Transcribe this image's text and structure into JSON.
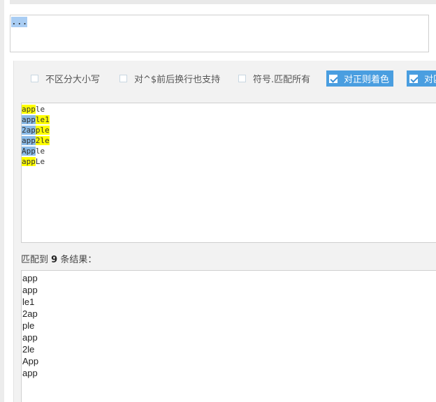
{
  "regex": {
    "value": "..."
  },
  "options": [
    {
      "label": "不区分大小写",
      "checked": false
    },
    {
      "label": "对^$前后换行也支持",
      "checked": false
    },
    {
      "label": "符号.匹配所有",
      "checked": false
    },
    {
      "label": "对正则着色",
      "checked": true
    },
    {
      "label": "对匹",
      "checked": true
    }
  ],
  "test_text": {
    "lines": [
      [
        {
          "t": "app",
          "c": "yellow"
        },
        {
          "t": "le",
          "c": ""
        }
      ],
      [
        {
          "t": "app",
          "c": "blue"
        },
        {
          "t": "le1",
          "c": "yellow"
        }
      ],
      [
        {
          "t": "2ap",
          "c": "blue"
        },
        {
          "t": "ple",
          "c": "yellow"
        }
      ],
      [
        {
          "t": "app",
          "c": "blue"
        },
        {
          "t": "2le",
          "c": "yellow"
        }
      ],
      [
        {
          "t": "App",
          "c": "blue"
        },
        {
          "t": "le",
          "c": ""
        }
      ],
      [
        {
          "t": "app",
          "c": "yellow"
        },
        {
          "t": "Le",
          "c": ""
        }
      ]
    ]
  },
  "result": {
    "prefix": "匹配到 ",
    "count": "9",
    "suffix": " 条结果：",
    "items": [
      "app",
      "app",
      "le1",
      "2ap",
      "ple",
      "app",
      "2le",
      "App",
      "app"
    ]
  },
  "colors": {
    "highlight_yellow": "#ffff00",
    "highlight_blue": "#8bbbe8",
    "checkbox_checked": "#4a9ee0"
  }
}
